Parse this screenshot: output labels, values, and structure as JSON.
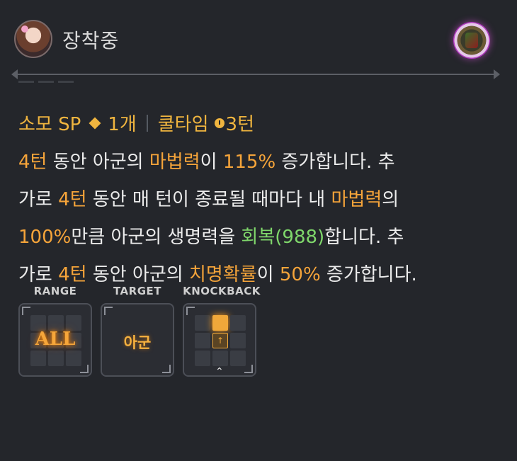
{
  "header": {
    "title": "장착중"
  },
  "skill": {
    "cost_label": "소모 SP",
    "cost_value": "1개",
    "cooldown_label": "쿨타임",
    "cooldown_value": "3턴"
  },
  "description": {
    "l1_a": "4턴",
    "l1_b": " 동안 아군의 ",
    "l1_c": "마법력",
    "l1_d": "이 ",
    "l1_e": "115%",
    "l1_f": " 증가합니다. 추",
    "l2_a": "가로 ",
    "l2_b": "4턴",
    "l2_c": " 동안 매 턴이 종료될 때마다 내 ",
    "l2_d": "마법력",
    "l2_e": "의",
    "l3_a": "100%",
    "l3_b": "만큼 아군의 생명력을 ",
    "l3_c": "회복(988)",
    "l3_d": "합니다. 추",
    "l4_a": "가로 ",
    "l4_b": "4턴",
    "l4_c": " 동안 아군의 ",
    "l4_d": "치명확률",
    "l4_e": "이 ",
    "l4_f": "50%",
    "l4_g": " 증가합니다."
  },
  "info": {
    "range_label": "RANGE",
    "range_value": "ALL",
    "target_label": "TARGET",
    "target_value": "아군",
    "knockback_label": "KNOCKBACK"
  },
  "colors": {
    "highlight": "#f5a43a",
    "heal": "#7fd76b",
    "background": "#24262b"
  },
  "icons": [
    "avatar",
    "unit-badge",
    "diamond-icon",
    "clock-icon",
    "knockback-up-arrow-icon",
    "chevron-up-icon"
  ]
}
